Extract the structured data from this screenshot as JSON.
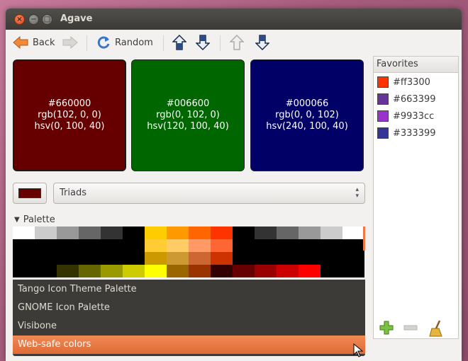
{
  "window": {
    "title": "Agave"
  },
  "toolbar": {
    "back_label": "Back",
    "random_label": "Random"
  },
  "swatches": [
    {
      "hex": "#660000",
      "rgb": "rgb(102, 0, 0)",
      "hsv": "hsv(0, 100, 40)"
    },
    {
      "hex": "#006600",
      "rgb": "rgb(0, 102, 0)",
      "hsv": "hsv(120, 100, 40)"
    },
    {
      "hex": "#000066",
      "rgb": "rgb(0, 0, 102)",
      "hsv": "hsv(240, 100, 40)"
    }
  ],
  "scheme": {
    "color": "#660000",
    "selected": "Triads"
  },
  "palette": {
    "label": "Palette",
    "rows": [
      [
        "#ffffff",
        "#cccccc",
        "#999999",
        "#666666",
        "#333333",
        "#000000",
        "#ffcc00",
        "#ff9900",
        "#ff6600",
        "#ff3300",
        "#000000",
        "#333333",
        "#666666",
        "#999999",
        "#cccccc",
        "#ffffff"
      ],
      [
        "#000000",
        "#000000",
        "#000000",
        "#000000",
        "#000000",
        "#000000",
        "#ffcc33",
        "#ffcc66",
        "#ff9966",
        "#ff6633",
        "#000000",
        "#000000",
        "#000000",
        "#000000",
        "#000000",
        "#000000"
      ],
      [
        "#000000",
        "#000000",
        "#000000",
        "#000000",
        "#000000",
        "#000000",
        "#cc9900",
        "#cc9933",
        "#cc6633",
        "#cc3300",
        "#000000",
        "#000000",
        "#000000",
        "#000000",
        "#000000",
        "#000000"
      ],
      [
        "#000000",
        "#000000",
        "#333300",
        "#666600",
        "#999900",
        "#cccc00",
        "#ffff00",
        "#996600",
        "#993300",
        "#330000",
        "#660000",
        "#990000",
        "#cc0000",
        "#ff0000",
        "#000000",
        "#000000"
      ]
    ],
    "menu_items": [
      "Tango Icon Theme Palette",
      "GNOME Icon Palette",
      "Visibone",
      "Web-safe colors"
    ],
    "selected_index": 3
  },
  "favorites": {
    "title": "Favorites",
    "items": [
      {
        "hex": "#ff3300"
      },
      {
        "hex": "#663399"
      },
      {
        "hex": "#9933cc"
      },
      {
        "hex": "#333399"
      }
    ]
  }
}
